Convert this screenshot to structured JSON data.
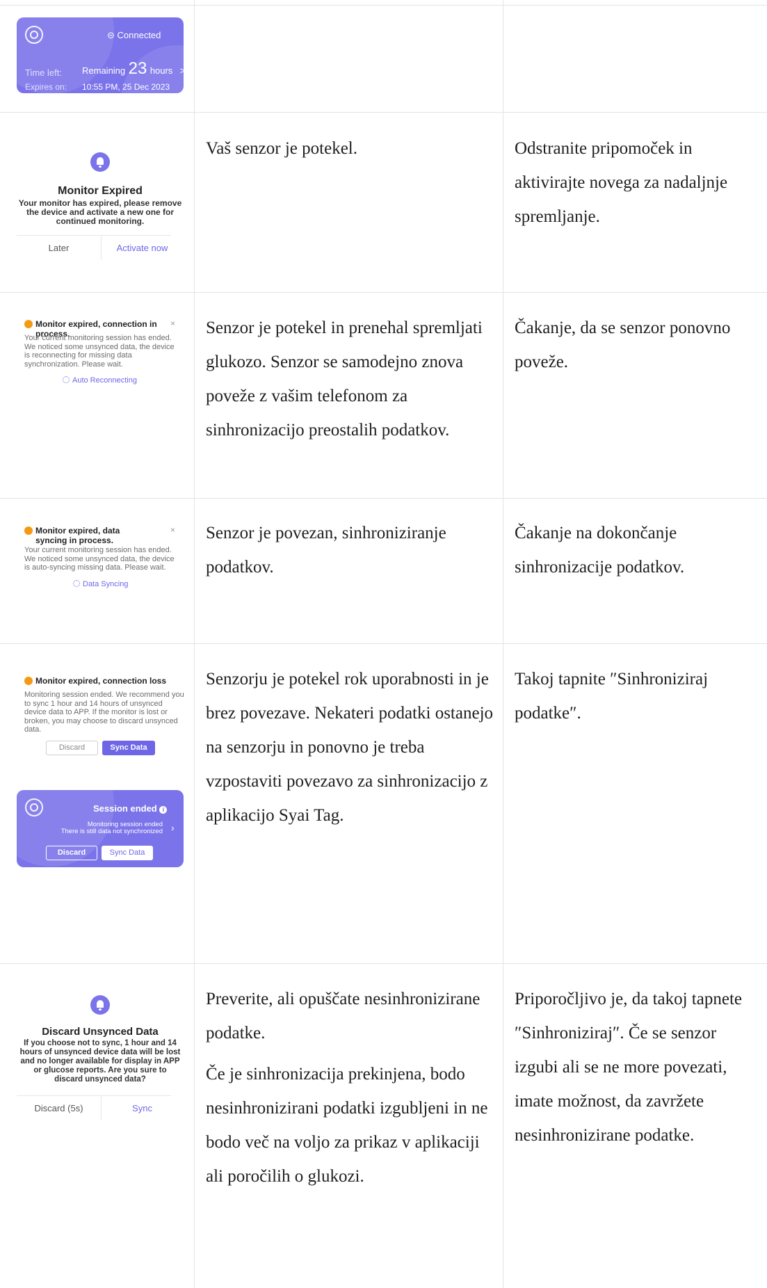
{
  "connected_card": {
    "status": "⊝ Connected",
    "time_left_label": "Time left:",
    "remaining_label": "Remaining",
    "remaining_value": "23",
    "remaining_unit": "hours",
    "chevron": ">",
    "expires_label": "Expires on:",
    "expires_value": "10:55 PM, 25 Dec 2023"
  },
  "rows": [
    {
      "screen": {
        "title": "Monitor Expired",
        "body": "Your monitor has expired, please remove the device and activate a new one for continued monitoring.",
        "left_button": "Later",
        "right_button": "Activate now"
      },
      "description": "Vaš senzor je potekel.",
      "action": "Odstranite pripomoček in aktivirajte novega za nadaljnje spremljanje."
    },
    {
      "screen": {
        "title": "Monitor expired, connection in process.",
        "close": "×",
        "body": "Your current monitoring session has ended. We noticed some unsynced data, the device is reconnecting for missing data synchronization. Please wait.",
        "link": "Auto Reconnecting"
      },
      "description": "Senzor je potekel in prenehal spremljati glukozo. Senzor se samodejno znova poveže z vašim telefonom za sinhronizacijo preostalih podatkov.",
      "action": "Čakanje, da se senzor ponovno poveže."
    },
    {
      "screen": {
        "title": "Monitor expired, data syncing in process.",
        "close": "×",
        "body": "Your current monitoring session has ended. We noticed some unsynced data, the device is auto-syncing missing data. Please wait.",
        "link": "Data Syncing"
      },
      "description": "Senzor je povezan, sinhroniziranje podatkov.",
      "action": "Čakanje na dokončanje sinhronizacije podatkov."
    },
    {
      "screen": {
        "title": "Monitor expired, connection loss",
        "body": "Monitoring session ended. We recommend you to sync 1 hour and 14 hours of unsynced device data to APP. If the monitor is lost or broken, you may choose to discard unsynced data.",
        "discard": "Discard",
        "sync": "Sync Data",
        "card_title": "Session ended",
        "card_line1": "Monitoring session ended",
        "card_line2": "There is still data not synchronized",
        "card_discard": "Discard",
        "card_sync": "Sync Data"
      },
      "description": "Senzorju je potekel rok uporabnosti in je brez povezave. Nekateri podatki ostanejo na senzorju in ponovno je treba vzpostaviti povezavo za sinhronizacijo z aplikacijo Syai Tag.",
      "action": "Takoj tapnite ″Sinhroniziraj podatke″."
    },
    {
      "screen": {
        "title": "Discard Unsynced Data",
        "body": "If you choose not to sync, 1 hour and 14 hours of unsynced device data will be lost and no longer available for display in APP or glucose reports. Are you sure to discard unsynced data?",
        "left_button": "Discard (5s)",
        "right_button": "Sync"
      },
      "description": "Preverite, ali opuščate nesinhronizirane podatke.",
      "description2": "Če je sinhronizacija prekinjena, bodo nesinhronizirani podatki izgubljeni in ne bodo več na voljo za prikaz v aplikaciji ali poročilih o glukozi.",
      "action": "Priporočljivo je, da takoj tapnete ″Sinhroniziraj″. Če se senzor izgubi ali se ne more povezati, imate možnost, da zavržete nesinhronizirane podatke."
    }
  ],
  "colors": {
    "accent": "#7b73ea",
    "warning": "#f39a12",
    "link": "#6e66e6",
    "grid": "#e3e3e3"
  }
}
